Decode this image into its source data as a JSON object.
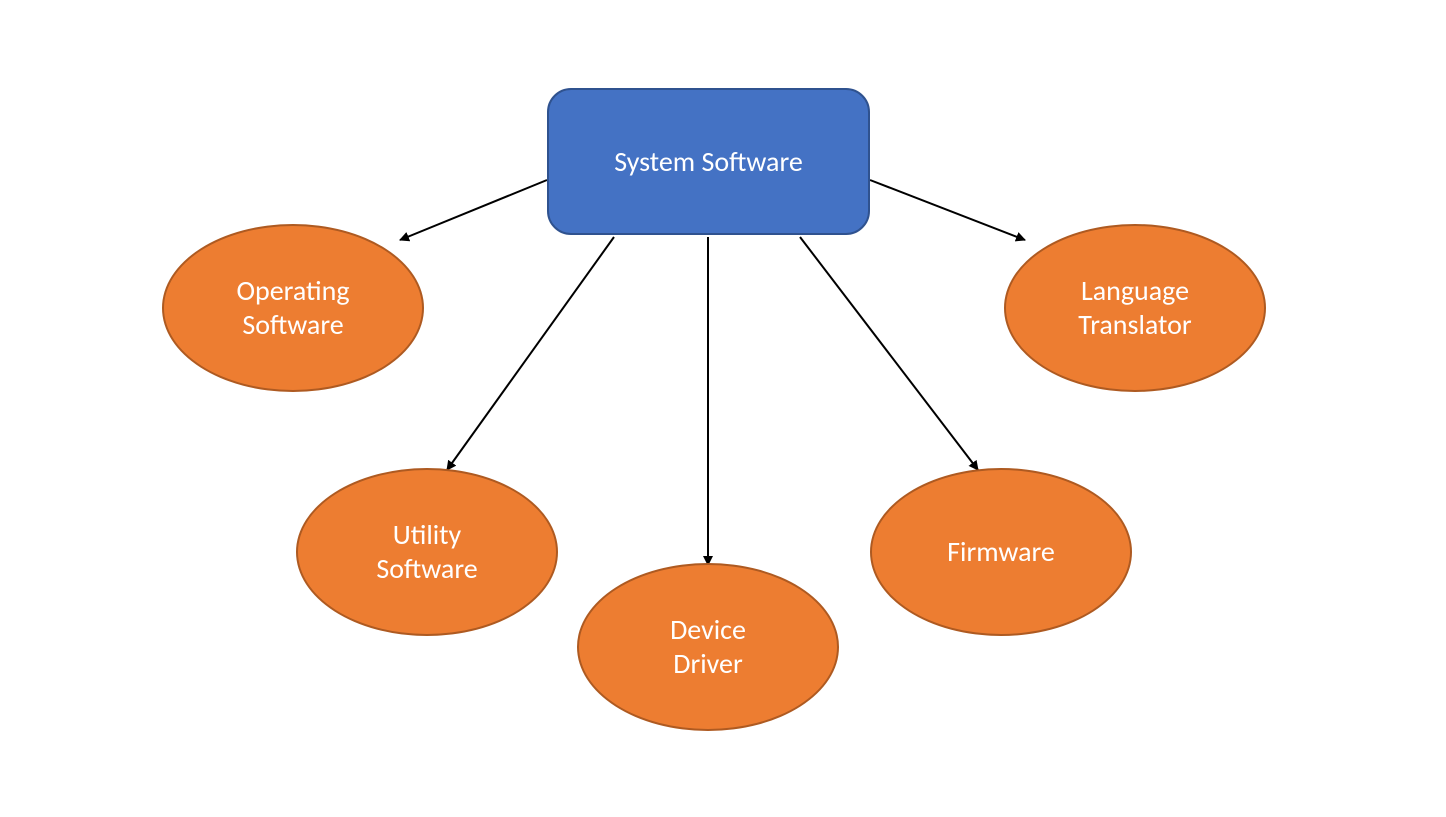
{
  "root": {
    "label": "System Software"
  },
  "children": {
    "operating_software": {
      "line1": "Operating",
      "line2": "Software"
    },
    "utility_software": {
      "line1": "Utility",
      "line2": "Software"
    },
    "device_driver": {
      "line1": "Device",
      "line2": "Driver"
    },
    "firmware": {
      "line1": "Firmware"
    },
    "language_translator": {
      "line1": "Language",
      "line2": "Translator"
    }
  }
}
